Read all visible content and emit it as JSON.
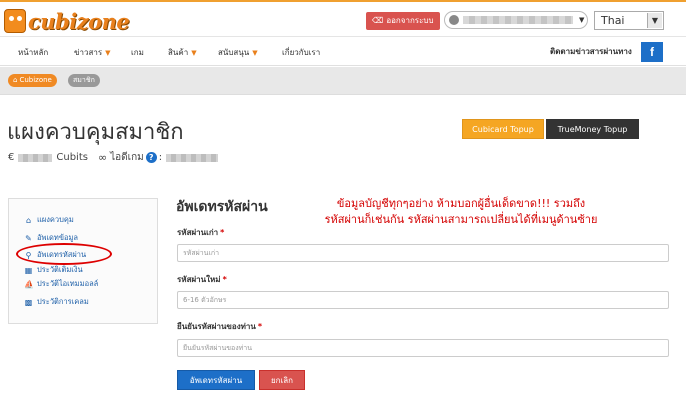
{
  "header": {
    "logo_text": "cubizone",
    "logout_label": "ออกจากระบบ",
    "language": "Thai"
  },
  "nav": {
    "items": [
      {
        "label": "หน้าหลัก",
        "dropdown": false
      },
      {
        "label": "ข่าวสาร",
        "dropdown": true
      },
      {
        "label": "เกม",
        "dropdown": false
      },
      {
        "label": "สินค้า",
        "dropdown": true
      },
      {
        "label": "สนับสนุน",
        "dropdown": true
      },
      {
        "label": "เกี่ยวกับเรา",
        "dropdown": false
      }
    ],
    "follow_text": "ติดตามข่าวสารผ่านทาง",
    "facebook_letter": "f"
  },
  "breadcrumb": {
    "home": "Cubizone",
    "current": "สมาชิก"
  },
  "page": {
    "title": "แผงควบคุมสมาชิก",
    "cubicard_button": "Cubicard Topup",
    "truemoney_button": "TrueMoney Topup",
    "currency_symbol": "€",
    "cubits_label": "Cubits",
    "game_id_label": "ไอดีเกม",
    "help_symbol": "?"
  },
  "sidebar": {
    "items": [
      {
        "label": "แผงควบคุม",
        "icon": "home-icon"
      },
      {
        "label": "อัพเดทข้อมูล",
        "icon": "edit-icon"
      },
      {
        "label": "อัพเดทรหัสผ่าน",
        "icon": "key-icon"
      },
      {
        "label": "ประวัติเติมเงิน",
        "icon": "list-icon"
      },
      {
        "label": "ประวัติไอเทมมอลล์",
        "icon": "cart-icon"
      },
      {
        "label": "ประวัติการเคลม",
        "icon": "gift-icon"
      }
    ]
  },
  "form": {
    "title": "อัพเดทรหัสผ่าน",
    "warning_line1": "ข้อมูลบัญชีทุกๆอย่าง ห้ามบอกผู้อื่นเด็ดขาด!!! รวมถึง",
    "warning_line2": "รหัสผ่านก็เช่นกัน รหัสผ่านสามารถเปลี่ยนได้ที่เมนูด้านซ้าย",
    "old_password_label": "รหัสผ่านเก่า",
    "old_password_placeholder": "รหัสผ่านเก่า",
    "new_password_label": "รหัสผ่านใหม่",
    "new_password_placeholder": "6-16 ตัวอักษร",
    "confirm_label": "ยืนยันรหัสผ่านของท่าน",
    "confirm_placeholder": "ยืนยันรหัสผ่านของท่าน",
    "required_mark": "*",
    "submit_label": "อัพเดทรหัสผ่าน",
    "cancel_label": "ยกเลิก"
  },
  "colors": {
    "brand_orange": "#f08a24",
    "primary_blue": "#1d6fc8",
    "danger_red": "#d9534f",
    "warning_text": "#d40000"
  }
}
